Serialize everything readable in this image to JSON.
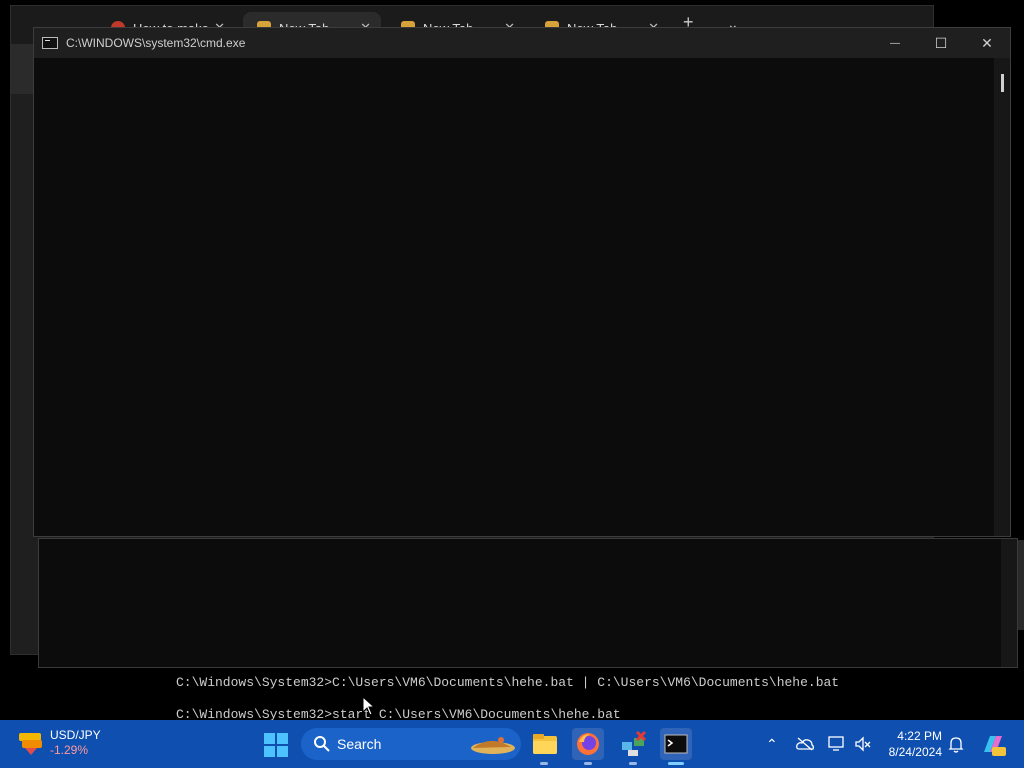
{
  "browser": {
    "tabs": [
      {
        "label": "How to make..."
      },
      {
        "label": "New Tab"
      },
      {
        "label": "New Tab"
      },
      {
        "label": "New Tab"
      }
    ],
    "new_tab_symbol": "+",
    "dropdown_symbol": "⌄"
  },
  "cmd_window": {
    "title": "C:\\WINDOWS\\system32\\cmd.exe",
    "minimize_symbol": "—",
    "maximize_symbol": "☐",
    "close_symbol": "✕"
  },
  "console": {
    "lines": [
      "C:\\Windows\\System32>C:\\Users\\VM6\\Documents\\hehe.bat | C:\\Users\\VM6\\Documents\\hehe.bat",
      "C:\\Windows\\System32>start C:\\Users\\VM6\\Documents\\hehe.bat"
    ]
  },
  "taskbar": {
    "widget": {
      "title": "USD/JPY",
      "change": "-1.29%"
    },
    "search_label": "Search",
    "clock": {
      "time": "4:22 PM",
      "date": "8/24/2024"
    },
    "apps": [
      "file-explorer-icon",
      "firefox-icon",
      "network-app-icon",
      "terminal-icon"
    ],
    "accent": "#0f4fb0"
  }
}
